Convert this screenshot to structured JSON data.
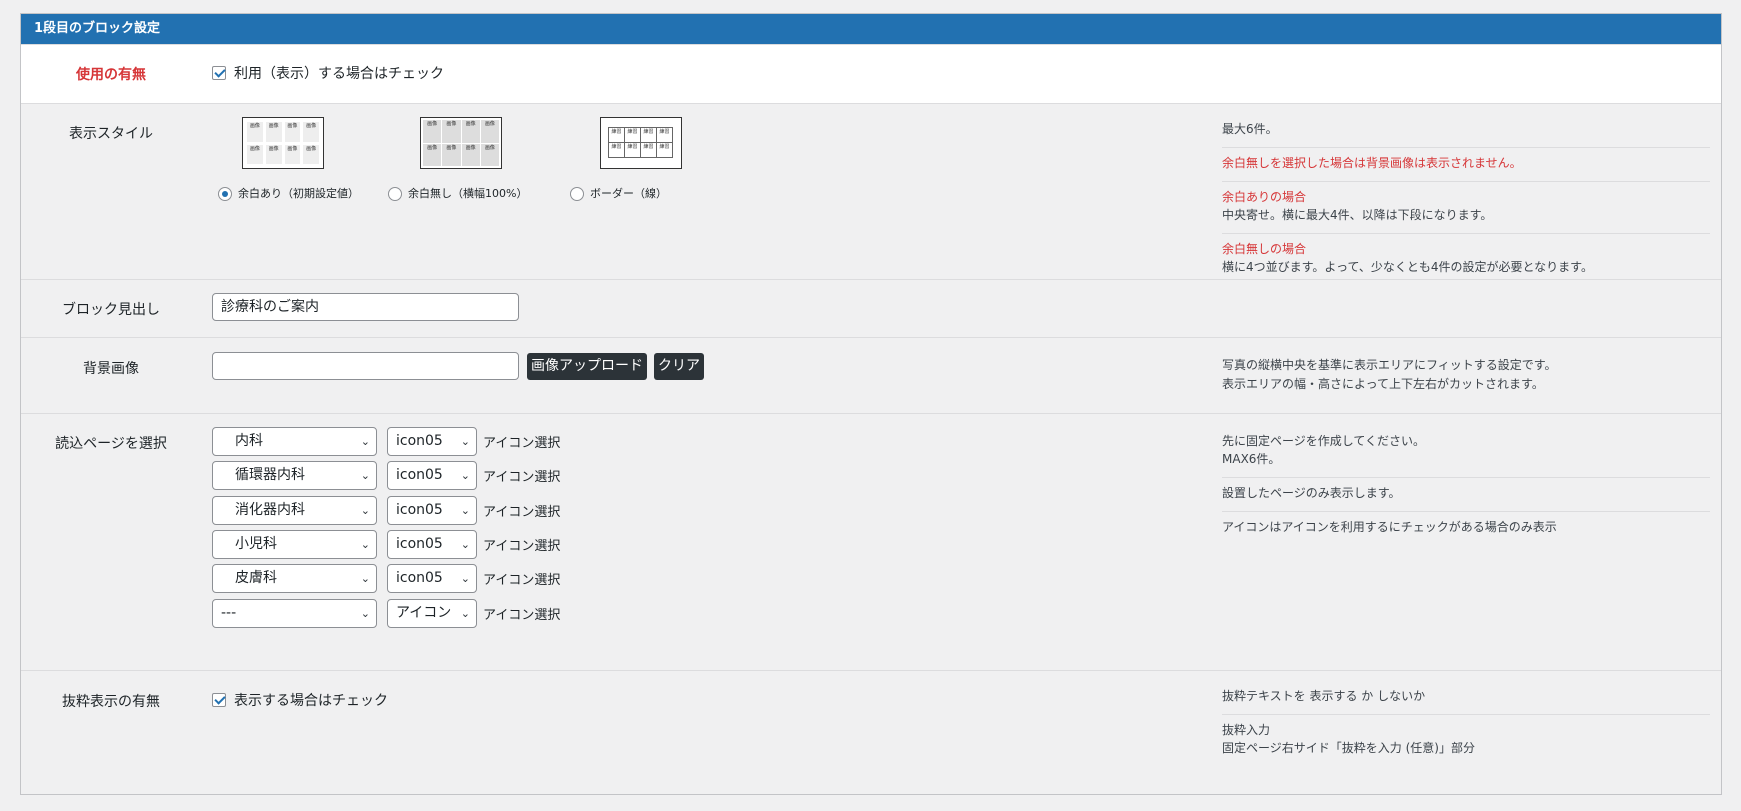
{
  "header": {
    "title": "1段目のブロック設定"
  },
  "usage": {
    "label": "使用の有無",
    "checkbox_label": "利用（表示）する場合はチェック"
  },
  "display_style": {
    "label": "表示スタイル",
    "thumb_text": "画像",
    "thumb_text_border": "練習",
    "options": [
      {
        "label": "余白あり（初期設定値）",
        "selected": true
      },
      {
        "label": "余白無し（横幅100%）",
        "selected": false
      },
      {
        "label": "ボーダー（線）",
        "selected": false
      }
    ],
    "notes": {
      "max": "最大6件。",
      "warning": "余白無しを選択した場合は背景画像は表示されません。",
      "with_margin_title": "余白ありの場合",
      "with_margin_desc": "中央寄せ。横に最大4件、以降は下段になります。",
      "no_margin_title": "余白無しの場合",
      "no_margin_desc": "横に4つ並びます。よって、少なくとも4件の設定が必要となります。"
    }
  },
  "block_heading": {
    "label": "ブロック見出し",
    "value": "診療科のご案内"
  },
  "background": {
    "label": "背景画像",
    "value": "",
    "upload_button": "画像アップロード",
    "clear_button": "クリア",
    "note1": "写真の縦横中央を基準に表示エリアにフィットする設定です。",
    "note2": "表示エリアの幅・高さによって上下左右がカットされます。"
  },
  "pages": {
    "label": "読込ページを選択",
    "icon_label": "アイコン選択",
    "rows": [
      {
        "page": "内科",
        "icon": "icon05"
      },
      {
        "page": "循環器内科",
        "icon": "icon05"
      },
      {
        "page": "消化器内科",
        "icon": "icon05"
      },
      {
        "page": "小児科",
        "icon": "icon05"
      },
      {
        "page": "皮膚科",
        "icon": "icon05"
      },
      {
        "page": "---",
        "icon": "アイコン"
      }
    ],
    "notes": {
      "n1": "先に固定ページを作成してください。",
      "n2": "MAX6件。",
      "n3": "設置したページのみ表示します。",
      "n4": "アイコンはアイコンを利用するにチェックがある場合のみ表示"
    }
  },
  "excerpt": {
    "label": "抜粋表示の有無",
    "checkbox_label": "表示する場合はチェック",
    "note1": "抜粋テキストを 表示する か しないか",
    "note2_title": "抜粋入力",
    "note2_desc": "固定ページ右サイド「抜粋を入力 (任意)」部分"
  },
  "colors": {
    "header_bg": "#2271b1",
    "accent_red": "#d63638"
  }
}
